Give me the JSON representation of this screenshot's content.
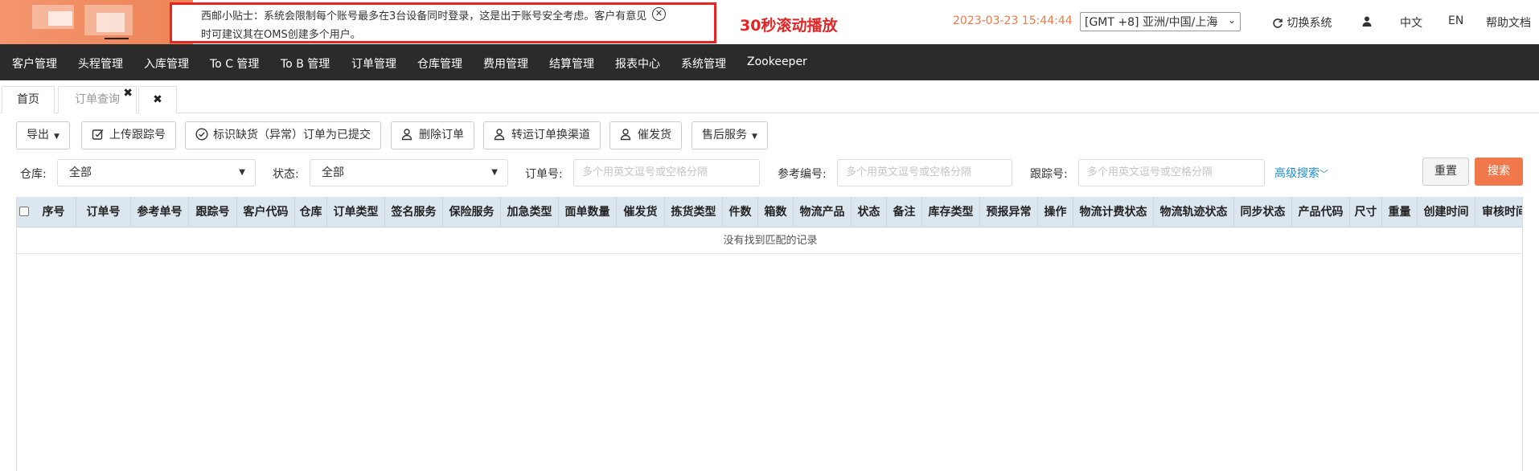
{
  "notice": {
    "text": "西邮小贴士：系统会限制每个账号最多在3台设备同时登录，这是出于账号安全考虑。客户有意见时可建议其在OMS创建多个用户。",
    "scroll_note": "30秒滚动播放"
  },
  "header": {
    "datetime": "2023-03-23 15:44:44",
    "timezone": "[GMT +8] 亚洲/中国/上海",
    "switch_system": "切换系统",
    "lang_cn": "中文",
    "lang_en": "EN",
    "help": "帮助文档"
  },
  "nav": {
    "items": [
      "客户管理",
      "头程管理",
      "入库管理",
      "To C 管理",
      "To B 管理",
      "订单管理",
      "仓库管理",
      "费用管理",
      "结算管理",
      "报表中心",
      "系统管理",
      "Zookeeper"
    ]
  },
  "tabs": [
    "首页",
    "订单查询"
  ],
  "toolbar": {
    "export": "导出",
    "upload_tracking": "上传跟踪号",
    "mark_submitted": "标识缺货（异常）订单为已提交",
    "delete_order": "删除订单",
    "transfer_channel": "转运订单换渠道",
    "urge_delivery": "催发货",
    "after_sales": "售后服务"
  },
  "filters": {
    "warehouse_label": "仓库:",
    "warehouse_value": "全部",
    "status_label": "状态:",
    "status_value": "全部",
    "order_no_label": "订单号:",
    "ref_no_label": "参考编号:",
    "tracking_label": "跟踪号:",
    "placeholder": "多个用英文逗号或空格分隔",
    "advanced": "高级搜索",
    "reset": "重置",
    "search": "搜索"
  },
  "table": {
    "columns": [
      "序号",
      "订单号",
      "参考单号",
      "跟踪号",
      "客户代码",
      "仓库",
      "订单类型",
      "签名服务",
      "保险服务",
      "加急类型",
      "面单数量",
      "催发货",
      "拣货类型",
      "件数",
      "箱数",
      "物流产品",
      "状态",
      "备注",
      "库存类型",
      "预报异常",
      "操作",
      "物流计费状态",
      "物流轨迹状态",
      "同步状态",
      "产品代码",
      "尺寸",
      "重量",
      "创建时间",
      "审核时间"
    ],
    "empty_text": "没有找到匹配的记录"
  },
  "colors": {
    "accent": "#f0784a",
    "nav_bg": "#2b2b2b",
    "notice_border": "#e62424",
    "link": "#1e8fd6",
    "table_header": "#dce6ef"
  }
}
